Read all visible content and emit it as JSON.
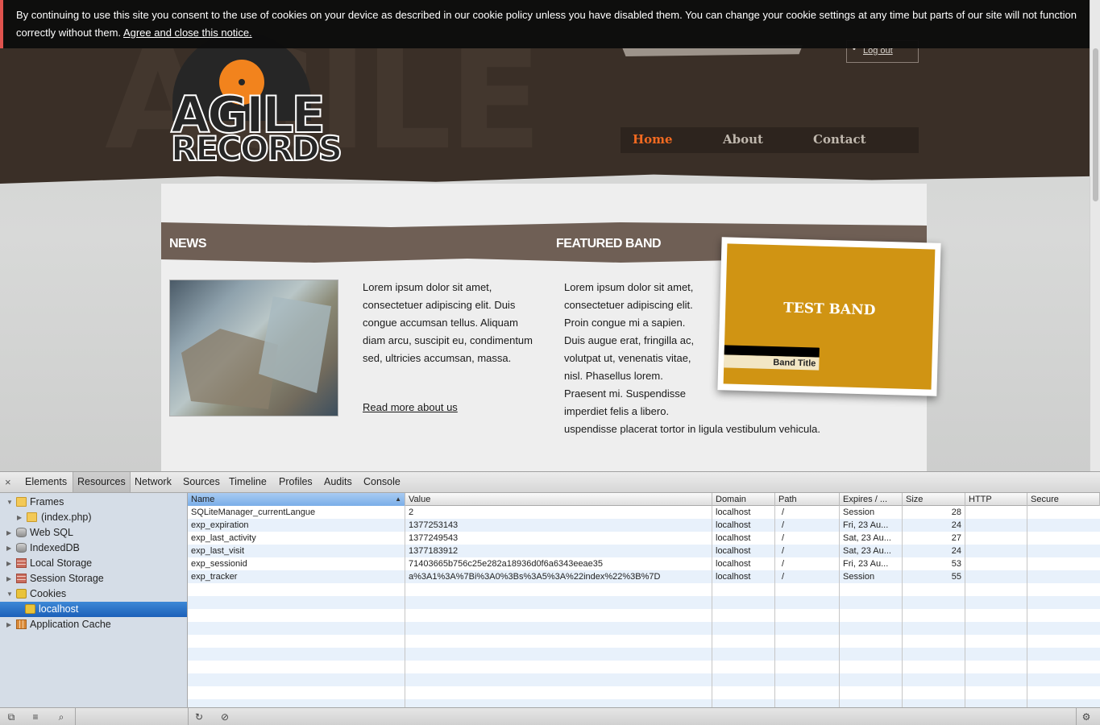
{
  "cookie_banner": {
    "message": "By continuing to use this site you consent to the use of cookies on your device as described in our cookie policy unless you have disabled them. You can change your cookie settings at any time but parts of our site will not function correctly without them.",
    "agree_link": "Agree and close this notice."
  },
  "site": {
    "header_bg_word": "AGILE",
    "logo": {
      "line1": "AGILE",
      "line2": "RECORDS"
    },
    "logout_bullet": "•",
    "logout": "Log out",
    "nav": [
      {
        "label": "Home",
        "active": true
      },
      {
        "label": "About",
        "active": false
      },
      {
        "label": "Contact",
        "active": false
      }
    ],
    "news": {
      "title": "NEWS",
      "text": "Lorem ipsum dolor sit amet, consectetuer adipiscing elit. Duis congue accumsan tellus. Aliquam diam arcu, suscipit eu, condimentum sed, ultricies accumsan, massa.",
      "read_more": "Read more about us"
    },
    "featured_band": {
      "title": "FEATURED BAND",
      "text": "Lorem ipsum dolor sit amet, consectetuer adipiscing elit. Proin congue mi a sapien. Duis augue erat, fringilla ac, volutpat ut, venenatis vitae, nisl. Phasellus lorem. Praesent mi. Suspendisse imperdiet felis a libero.",
      "text_last": "uspendisse placerat tortor in ligula vestibulum vehicula.",
      "band_name": "TEST BAND",
      "band_caption": "Band Title"
    }
  },
  "devtools": {
    "close": "×",
    "tabs": [
      "Elements",
      "Resources",
      "Network",
      "Sources",
      "Timeline",
      "Profiles",
      "Audits",
      "Console"
    ],
    "active_tab": "Resources",
    "tree": [
      {
        "label": "Frames",
        "icon": "folder-icon",
        "expanded": true
      },
      {
        "label": "(index.php)",
        "icon": "folder-icon",
        "expanded": false
      },
      {
        "label": "Web SQL",
        "icon": "database-icon",
        "expanded": false
      },
      {
        "label": "IndexedDB",
        "icon": "database-icon",
        "expanded": false
      },
      {
        "label": "Local Storage",
        "icon": "storage-grid-icon",
        "expanded": false
      },
      {
        "label": "Session Storage",
        "icon": "storage-grid-icon",
        "expanded": false
      },
      {
        "label": "Cookies",
        "icon": "cookie-icon",
        "expanded": true
      },
      {
        "label": "localhost",
        "icon": "cookie-icon",
        "selected": true
      },
      {
        "label": "Application Cache",
        "icon": "app-cache-icon",
        "expanded": false
      }
    ],
    "columns": [
      "Name",
      "Value",
      "Domain",
      "Path",
      "Expires / ...",
      "Size",
      "HTTP",
      "Secure"
    ],
    "sorted_column": "Name",
    "rows": [
      {
        "name": "SQLiteManager_currentLangue",
        "value": "2",
        "domain": "localhost",
        "path": "/",
        "expires": "Session",
        "size": "28",
        "http": "",
        "secure": ""
      },
      {
        "name": "exp_expiration",
        "value": "1377253143",
        "domain": "localhost",
        "path": "/",
        "expires": "Fri, 23 Au...",
        "size": "24",
        "http": "",
        "secure": ""
      },
      {
        "name": "exp_last_activity",
        "value": "1377249543",
        "domain": "localhost",
        "path": "/",
        "expires": "Sat, 23 Au...",
        "size": "27",
        "http": "",
        "secure": ""
      },
      {
        "name": "exp_last_visit",
        "value": "1377183912",
        "domain": "localhost",
        "path": "/",
        "expires": "Sat, 23 Au...",
        "size": "24",
        "http": "",
        "secure": ""
      },
      {
        "name": "exp_sessionid",
        "value": "71403665b756c25e282a18936d0f6a6343eeae35",
        "domain": "localhost",
        "path": "/",
        "expires": "Fri, 23 Au...",
        "size": "53",
        "http": "",
        "secure": ""
      },
      {
        "name": "exp_tracker",
        "value": "a%3A1%3A%7Bi%3A0%3Bs%3A5%3A%22index%22%3B%7D",
        "domain": "localhost",
        "path": "/",
        "expires": "Session",
        "size": "55",
        "http": "",
        "secure": ""
      }
    ],
    "statusbar": {
      "dock_icon": "⧉",
      "console_icon": "≡",
      "search_icon": "⌕",
      "refresh_icon": "↻",
      "clear_icon": "⊘",
      "settings_icon": "⚙"
    }
  }
}
